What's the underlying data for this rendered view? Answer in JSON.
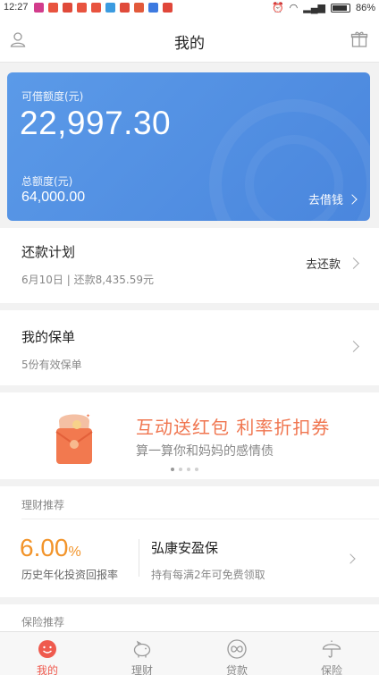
{
  "status_bar": {
    "time": "12:27",
    "battery": "86%"
  },
  "header": {
    "title": "我的"
  },
  "credit": {
    "available_label": "可借额度(元)",
    "available_amount": "22,997.30",
    "total_label": "总额度(元)",
    "total_amount": "64,000.00",
    "action_label": "去借钱"
  },
  "repayment": {
    "title": "还款计划",
    "subtitle": "6月10日 | 还款8,435.59元",
    "action_label": "去还款"
  },
  "policy": {
    "title": "我的保单",
    "subtitle": "5份有效保单"
  },
  "banner": {
    "title": "互动送红包 利率折扣券",
    "subtitle": "算一算你和妈妈的感情债"
  },
  "finance": {
    "section_title": "理财推荐",
    "rate_value": "6.00",
    "rate_unit": "%",
    "rate_label": "历史年化投资回报率",
    "product_name": "弘康安盈保",
    "product_desc": "持有每满2年可免费领取"
  },
  "insurance": {
    "section_title": "保险推荐"
  },
  "tabs": [
    {
      "label": "我的",
      "icon": "smile-icon",
      "active": true
    },
    {
      "label": "理财",
      "icon": "piggy-bank-icon",
      "active": false
    },
    {
      "label": "贷款",
      "icon": "loan-icon",
      "active": false
    },
    {
      "label": "保险",
      "icon": "umbrella-icon",
      "active": false
    }
  ],
  "colors": {
    "card_blue": "#4a86dd",
    "accent_orange": "#f2942a",
    "banner_orange": "#f07650",
    "tab_active": "#ef5a4e"
  }
}
